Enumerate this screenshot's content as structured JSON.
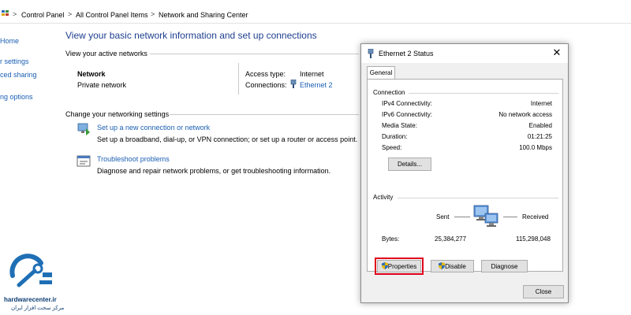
{
  "breadcrumb": {
    "items": [
      "Control Panel",
      "All Control Panel Items",
      "Network and Sharing Center"
    ],
    "separator": ">"
  },
  "leftnav": {
    "items": [
      "Home",
      "r settings",
      "ced sharing",
      "ng options"
    ]
  },
  "main": {
    "title": "View your basic network information and set up connections",
    "active_networks_heading": "View your active networks",
    "network_name": "Network",
    "network_type": "Private network",
    "access_type_label": "Access type:",
    "access_type_value": "Internet",
    "connections_label": "Connections:",
    "connections_value": "Ethernet 2",
    "change_settings_heading": "Change your networking settings",
    "tasks": [
      {
        "link": "Set up a new connection or network",
        "description": "Set up a broadband, dial-up, or VPN connection; or set up a router or access point.",
        "icon": "new-connection-icon"
      },
      {
        "link": "Troubleshoot problems",
        "description": "Diagnose and repair network problems, or get troubleshooting information.",
        "icon": "troubleshoot-icon"
      }
    ]
  },
  "dialog": {
    "title": "Ethernet 2 Status",
    "close_glyph": "✕",
    "tab": "General",
    "connection_heading": "Connection",
    "rows": [
      {
        "label": "IPv4 Connectivity:",
        "value": "Internet"
      },
      {
        "label": "IPv6 Connectivity:",
        "value": "No network access"
      },
      {
        "label": "Media State:",
        "value": "Enabled"
      },
      {
        "label": "Duration:",
        "value": "01:21:25"
      },
      {
        "label": "Speed:",
        "value": "100.0 Mbps"
      }
    ],
    "details_button": "Details...",
    "activity_heading": "Activity",
    "sent_label": "Sent",
    "received_label": "Received",
    "bytes_label": "Bytes:",
    "bytes_sent": "25,384,277",
    "bytes_received": "115,298,048",
    "properties_button": "Properties",
    "disable_button": "Disable",
    "diagnose_button": "Diagnose",
    "close_button": "Close"
  },
  "watermark": {
    "site": "hardwarecenter.ir",
    "tagline": "مرکز سخت افزار ایران"
  },
  "colors": {
    "link": "#1a5fb4",
    "title": "#1e3f8f",
    "highlight": "#e0001a",
    "logo": "#1f6fb5"
  }
}
